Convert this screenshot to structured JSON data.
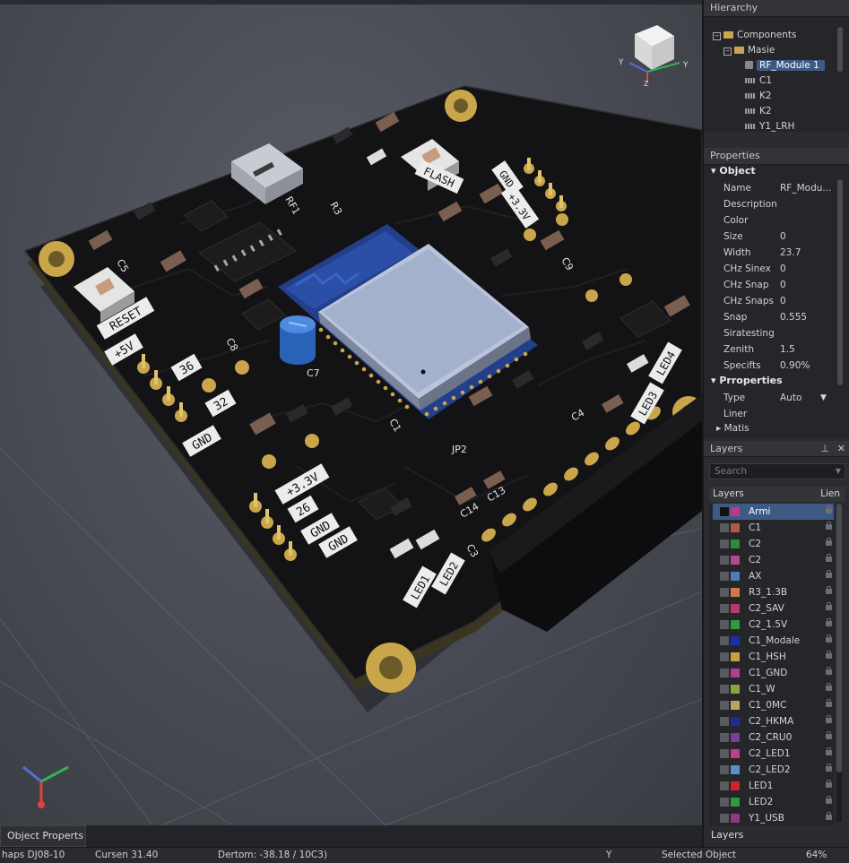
{
  "hierarchy": {
    "title": "Hierarchy",
    "items": [
      {
        "label": "Components"
      },
      {
        "label": "Masie"
      },
      {
        "label": "RF_Module",
        "badge": "1"
      },
      {
        "label": "C1"
      },
      {
        "label": "K2"
      },
      {
        "label": "K2"
      },
      {
        "label": "Y1_LRH"
      }
    ]
  },
  "properties": {
    "title": "Properties",
    "section_object": "Object",
    "rows": [
      {
        "key": "Name",
        "value": "RF_Modu..."
      },
      {
        "key": "Description",
        "value": ""
      },
      {
        "key": "Color",
        "value": ""
      },
      {
        "key": "Size",
        "value": "0"
      },
      {
        "key": "Width",
        "value": "23.7"
      },
      {
        "key": "CHz Sinex",
        "value": "0"
      },
      {
        "key": "CHz Snap",
        "value": "0"
      },
      {
        "key": "CHz Snaps",
        "value": "0"
      },
      {
        "key": "Snap",
        "value": "0.555"
      },
      {
        "key": "Siratesting",
        "value": ""
      },
      {
        "key": "Zenith",
        "value": "1.5"
      },
      {
        "key": "Specifts",
        "value": "0.90%"
      }
    ],
    "section_props": "Prroperties",
    "rows2": [
      {
        "key": "Type",
        "value": "Auto"
      },
      {
        "key": "Liner",
        "value": ""
      },
      {
        "key": "Matis",
        "value": ""
      }
    ]
  },
  "layers": {
    "title": "Layers",
    "search_placeholder": "Search",
    "col_layers": "Layers",
    "col_lien": "Lien",
    "items": [
      {
        "label": "Armi",
        "color": "#c0388a"
      },
      {
        "label": "C1",
        "color": "#b25b3a"
      },
      {
        "label": "C2",
        "color": "#2f8a3b"
      },
      {
        "label": "C2",
        "color": "#b14a8c"
      },
      {
        "label": "AX",
        "color": "#4f7bb8"
      },
      {
        "label": "R3_1.3B",
        "color": "#d1774a"
      },
      {
        "label": "C2_SAV",
        "color": "#b43a73"
      },
      {
        "label": "C2_1.5V",
        "color": "#2e9b3e"
      },
      {
        "label": "C1_Modale",
        "color": "#1c2fa8"
      },
      {
        "label": "C1_HSH",
        "color": "#c9a03b"
      },
      {
        "label": "C1_GND",
        "color": "#b23e8f"
      },
      {
        "label": "C1_W",
        "color": "#8fa139"
      },
      {
        "label": "C1_0MC",
        "color": "#c2a15a"
      },
      {
        "label": "C2_HKMA",
        "color": "#1c2a9a"
      },
      {
        "label": "C2_CRU0",
        "color": "#7e3a9c"
      },
      {
        "label": "C2_LED1",
        "color": "#bd3f8c"
      },
      {
        "label": "C2_LED2",
        "color": "#5c8fc9"
      },
      {
        "label": "LED1",
        "color": "#d3222a"
      },
      {
        "label": "LED2",
        "color": "#2f9a3d"
      },
      {
        "label": "Y1_USB",
        "color": "#8f3a7e"
      }
    ]
  },
  "bottom": {
    "object_tab": "Object Properts",
    "layers_tab": "Layers"
  },
  "status": {
    "s1": "haps DJ08-10",
    "s2": "Cursen 31.40",
    "s3": "Dertom: -38.18 / 10C3)",
    "s4": "Y",
    "s5": "Selected Object",
    "s6": "64%"
  },
  "board": {
    "labels": [
      "RESET",
      "+5V",
      "36",
      "32",
      "GND",
      "+3.3V",
      "26",
      "GND",
      "GND",
      "LED1",
      "LED2",
      "JP2",
      "C7",
      "C5",
      "C14",
      "C13",
      "C3",
      "LED4",
      "LED3",
      "FLASH",
      "GND",
      "+3.3V",
      "C1",
      "RF1",
      "C4",
      "R3",
      "C8",
      "C9"
    ]
  },
  "colors": {
    "accent": "#3d5a84",
    "pcb": "#141416",
    "silk": "#e8e8e8",
    "gold": "#c9a64a"
  }
}
